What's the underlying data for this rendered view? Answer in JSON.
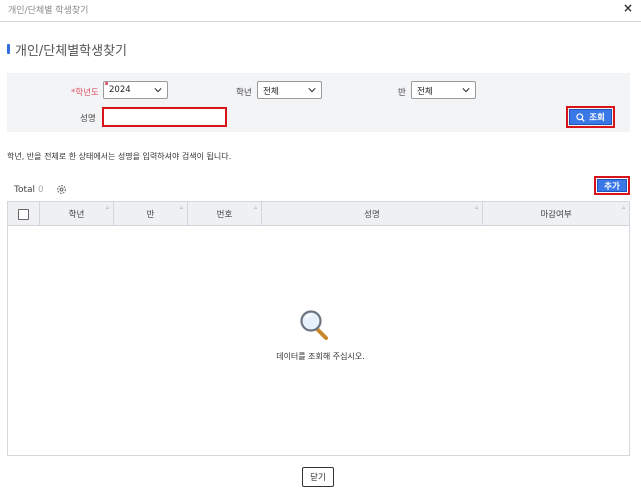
{
  "window": {
    "title": "개인/단체별 학생찾기",
    "close_glyph": "×"
  },
  "page": {
    "title": "개인/단체별학생찾기"
  },
  "search": {
    "year_label": "*학년도",
    "year_value": "2024",
    "grade_label": "학년",
    "grade_value": "전체",
    "class_label": "반",
    "class_value": "전체",
    "name_label": "성명",
    "name_value": "",
    "search_button": "조회"
  },
  "notice": "학년, 반을 전체로 한 상태에서는 성명을 입력하셔야 검색이 됩니다.",
  "toolbar": {
    "total_label": "Total",
    "total_count": "0",
    "add_button": "추가"
  },
  "grid": {
    "columns": [
      "학년",
      "반",
      "번호",
      "성명",
      "마감여부"
    ],
    "sort_glyph": "▵",
    "empty_message": "데이터를 조회해 주십시오."
  },
  "footer": {
    "close_button": "닫기"
  },
  "colors": {
    "accent": "#3b78e7",
    "highlight_border": "#d8141b",
    "required": "#e0556a"
  }
}
